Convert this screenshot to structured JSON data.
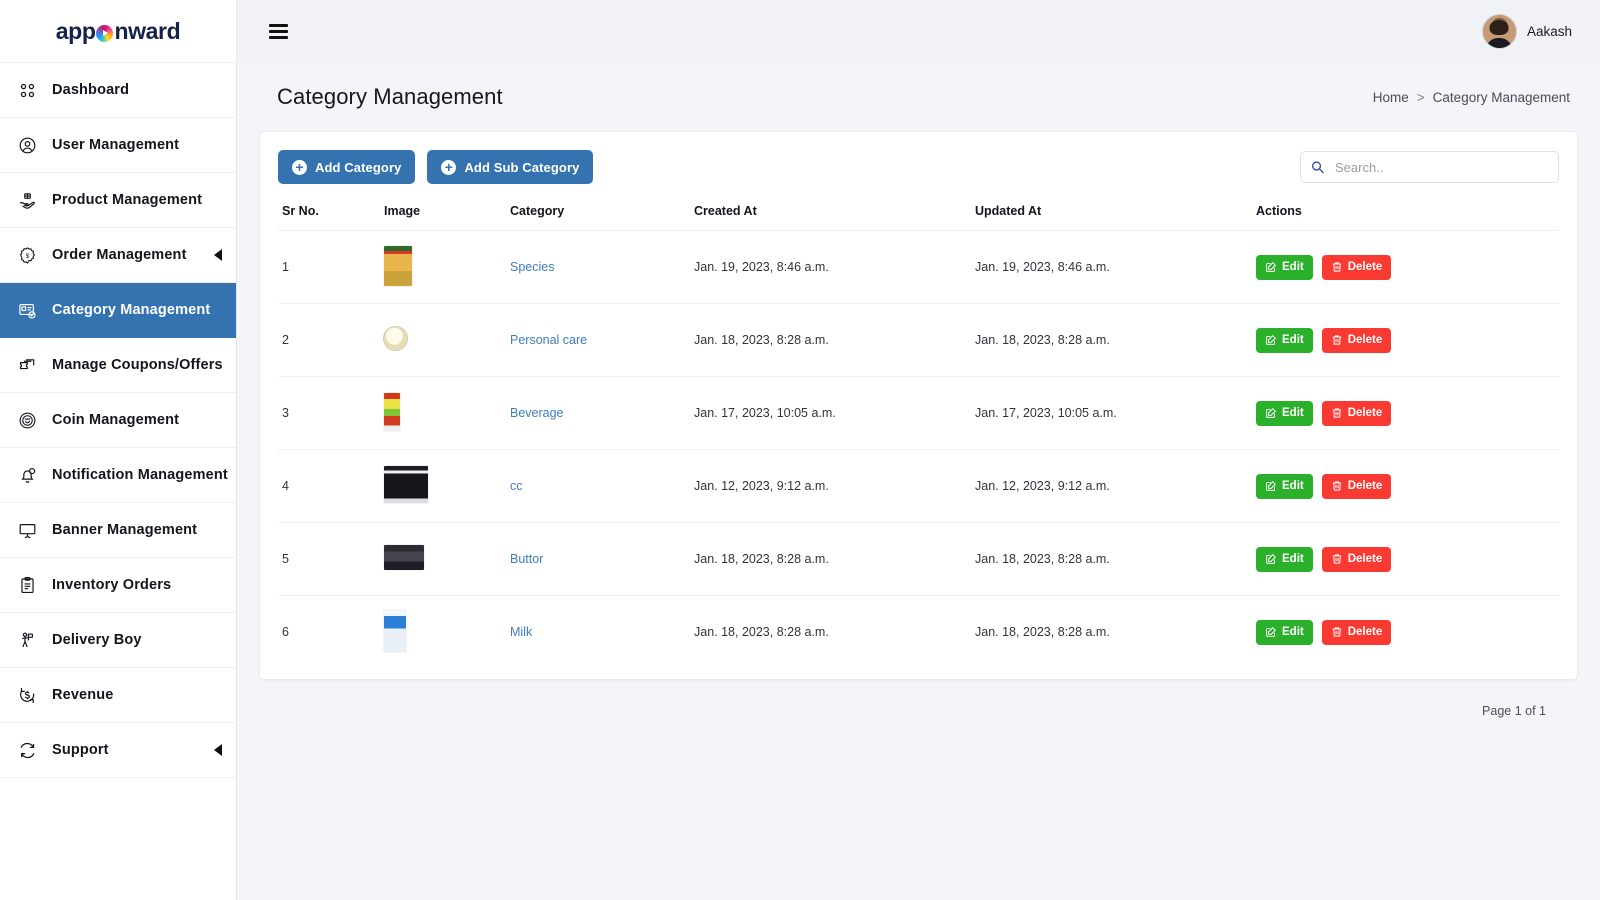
{
  "brand": {
    "text_before": "app",
    "text_after": "nward",
    "mark": "gradient-circle-play-icon"
  },
  "sidebar": {
    "items": [
      {
        "label": "Dashboard",
        "icon": "grid-icon",
        "active": false,
        "expandable": false
      },
      {
        "label": "User Management",
        "icon": "user-circle-icon",
        "active": false,
        "expandable": false
      },
      {
        "label": "Product Management",
        "icon": "hand-box-icon",
        "active": false,
        "expandable": false
      },
      {
        "label": "Order Management",
        "icon": "gear-badge-icon",
        "active": false,
        "expandable": true
      },
      {
        "label": "Category Management",
        "icon": "id-card-check-icon",
        "active": true,
        "expandable": false
      },
      {
        "label": "Manage Coupons/Offers",
        "icon": "ticket-icon",
        "active": false,
        "expandable": false
      },
      {
        "label": "Coin Management",
        "icon": "coin-icon",
        "active": false,
        "expandable": false
      },
      {
        "label": "Notification Management",
        "icon": "bell-icon",
        "active": false,
        "expandable": false
      },
      {
        "label": "Banner Management",
        "icon": "monitor-icon",
        "active": false,
        "expandable": false
      },
      {
        "label": "Inventory Orders",
        "icon": "clipboard-icon",
        "active": false,
        "expandable": false
      },
      {
        "label": "Delivery Boy",
        "icon": "delivery-person-icon",
        "active": false,
        "expandable": false
      },
      {
        "label": "Revenue",
        "icon": "dollar-refresh-icon",
        "active": false,
        "expandable": false
      },
      {
        "label": "Support",
        "icon": "refresh-icon",
        "active": false,
        "expandable": true
      }
    ]
  },
  "topbar": {
    "menu_icon": "hamburger-icon",
    "user_name": "Aakash",
    "avatar": "user-avatar"
  },
  "page": {
    "title": "Category Management",
    "breadcrumb": {
      "home": "Home",
      "separator": ">",
      "current": "Category Management"
    }
  },
  "toolbar": {
    "add_category_label": "Add Category",
    "add_sub_category_label": "Add Sub Category",
    "plus_icon": "plus-circle-icon"
  },
  "search": {
    "value": "",
    "placeholder": "Search..",
    "icon": "search-icon"
  },
  "table": {
    "columns": [
      "Sr No.",
      "Image",
      "Category",
      "Created At",
      "Updated At",
      "Actions"
    ],
    "rows": [
      {
        "sr": "1",
        "image": "spice-packet-thumbnail",
        "thumb_class": "th-1",
        "category": "Species",
        "created_at": "Jan. 19, 2023, 8:46 a.m.",
        "updated_at": "Jan. 19, 2023, 8:46 a.m."
      },
      {
        "sr": "2",
        "image": "soap-round-thumbnail",
        "thumb_class": "th-2",
        "category": "Personal care",
        "created_at": "Jan. 18, 2023, 8:28 a.m.",
        "updated_at": "Jan. 18, 2023, 8:28 a.m."
      },
      {
        "sr": "3",
        "image": "juice-carton-thumbnail",
        "thumb_class": "th-3",
        "category": "Beverage",
        "created_at": "Jan. 17, 2023, 10:05 a.m.",
        "updated_at": "Jan. 17, 2023, 10:05 a.m."
      },
      {
        "sr": "4",
        "image": "screenshot-thumbnail",
        "thumb_class": "th-4",
        "category": "cc",
        "created_at": "Jan. 12, 2023, 9:12 a.m.",
        "updated_at": "Jan. 12, 2023, 9:12 a.m."
      },
      {
        "sr": "5",
        "image": "electronics-thumbnail",
        "thumb_class": "th-5",
        "category": "Buttor",
        "created_at": "Jan. 18, 2023, 8:28 a.m.",
        "updated_at": "Jan. 18, 2023, 8:28 a.m."
      },
      {
        "sr": "6",
        "image": "milk-carton-thumbnail",
        "thumb_class": "th-6",
        "category": "Milk",
        "created_at": "Jan. 18, 2023, 8:28 a.m.",
        "updated_at": "Jan. 18, 2023, 8:28 a.m."
      }
    ],
    "row_actions": {
      "edit_label": "Edit",
      "edit_icon": "pencil-square-icon",
      "delete_label": "Delete",
      "delete_icon": "trash-icon"
    }
  },
  "pagination": {
    "text": "Page 1 of 1"
  },
  "colors": {
    "accent_blue": "#3572b0",
    "edit_green": "#2bb02b",
    "delete_red": "#f83a33",
    "link_blue": "#3e7cc0",
    "page_bg": "#f4f4f9",
    "topbar_bg": "#f1f2f5"
  }
}
